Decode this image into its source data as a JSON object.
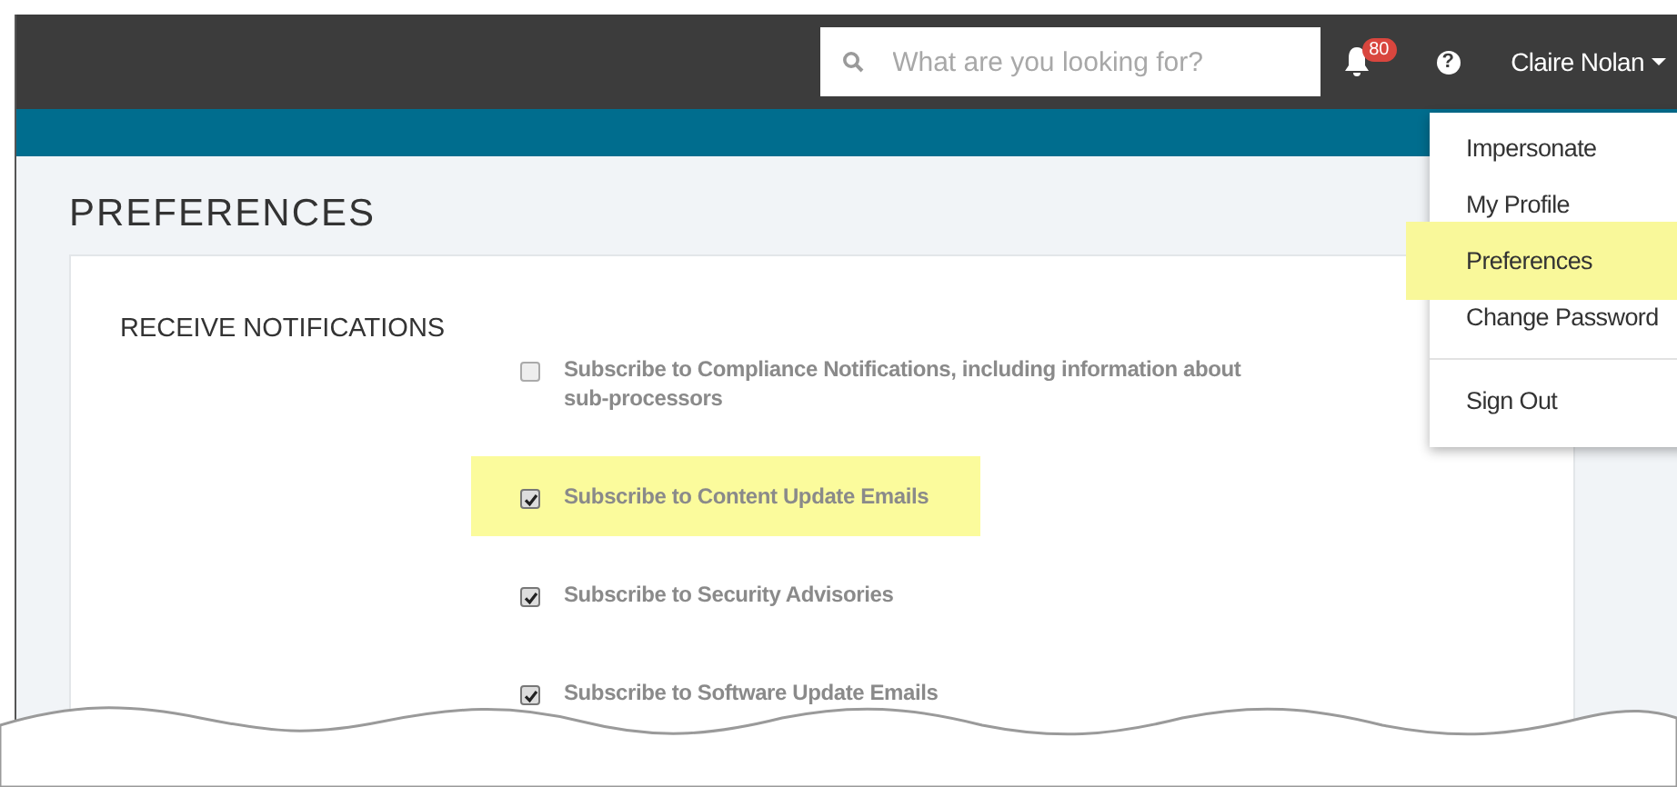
{
  "header": {
    "search": {
      "placeholder": "What are you looking for?"
    },
    "notifications": {
      "count": "80"
    },
    "help": "?",
    "user": {
      "name": "Claire Nolan"
    }
  },
  "user_menu": {
    "items": [
      {
        "label": "Impersonate",
        "highlighted": false,
        "divider_before": false
      },
      {
        "label": "My Profile",
        "highlighted": false,
        "divider_before": false
      },
      {
        "label": "Preferences",
        "highlighted": true,
        "divider_before": false
      },
      {
        "label": "Change Password",
        "highlighted": false,
        "divider_before": false
      },
      {
        "label": "Sign Out",
        "highlighted": false,
        "divider_before": true
      }
    ]
  },
  "page": {
    "title": "PREFERENCES",
    "section": "RECEIVE NOTIFICATIONS",
    "options": [
      {
        "label": "Subscribe to Compliance Notifications, including information about sub-processors",
        "checked": false,
        "highlighted": false
      },
      {
        "label": "Subscribe to Content Update Emails",
        "checked": true,
        "highlighted": true
      },
      {
        "label": "Subscribe to Security Advisories",
        "checked": true,
        "highlighted": false
      },
      {
        "label": "Subscribe to Software Update Emails",
        "checked": true,
        "highlighted": false
      }
    ]
  }
}
